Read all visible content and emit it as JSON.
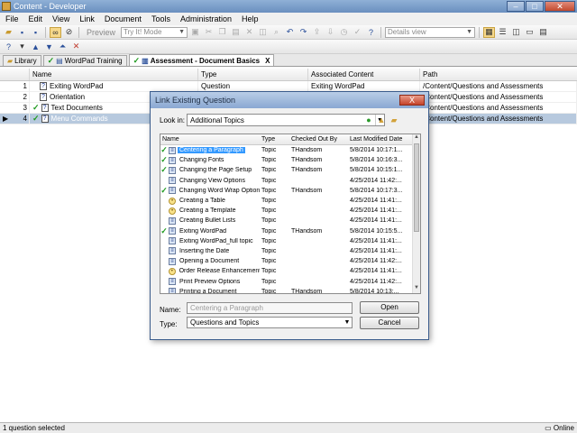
{
  "window": {
    "title": "Content - Developer"
  },
  "menu": [
    "File",
    "Edit",
    "View",
    "Link",
    "Document",
    "Tools",
    "Administration",
    "Help"
  ],
  "toolbar": {
    "preview_label": "Preview",
    "mode_combo": "Try It! Mode",
    "view_combo": "Details view"
  },
  "tabs": [
    {
      "label": "Library"
    },
    {
      "label": "WordPad Training"
    },
    {
      "label": "Assessment - Document Basics",
      "close": "X"
    }
  ],
  "grid": {
    "columns": [
      "Name",
      "Type",
      "Associated Content",
      "Path"
    ],
    "rows": [
      {
        "num": "1",
        "name": "Exiting WordPad",
        "type": "Question",
        "content": "Exiting WordPad",
        "path": "/Content/Questions and Assessments",
        "checked": false,
        "selected": false,
        "pointer": ""
      },
      {
        "num": "2",
        "name": "Orientation",
        "type": "Question",
        "content": "",
        "path": "/Content/Questions and Assessments",
        "checked": false,
        "selected": false,
        "pointer": ""
      },
      {
        "num": "3",
        "name": "Text Documents",
        "type": "Question",
        "content": "",
        "path": "/Content/Questions and Assessments",
        "checked": true,
        "selected": false,
        "pointer": ""
      },
      {
        "num": "4",
        "name": "Menu Commands",
        "type": "Question",
        "content": "",
        "path": "/Content/Questions and Assessments",
        "checked": true,
        "selected": true,
        "pointer": "▶"
      }
    ]
  },
  "status": {
    "left": "1 question selected",
    "right": "Online"
  },
  "dialog": {
    "title": "Link Existing Question",
    "close": "X",
    "lookin_label": "Look in:",
    "lookin_value": "Additional Topics",
    "columns": [
      "Name",
      "Type",
      "Checked Out By",
      "Last Modified Date"
    ],
    "items": [
      {
        "name": "Centering a Paragraph",
        "type": "Topic",
        "by": "THandsom",
        "date": "5/8/2014 10:17:1...",
        "checked": true,
        "icon": "doc",
        "selected": true
      },
      {
        "name": "Changing Fonts",
        "type": "Topic",
        "by": "THandsom",
        "date": "5/8/2014 10:16:3...",
        "checked": true,
        "icon": "doc",
        "selected": false
      },
      {
        "name": "Changing the Page Setup",
        "type": "Topic",
        "by": "THandsom",
        "date": "5/8/2014 10:15:1...",
        "checked": true,
        "icon": "doc",
        "selected": false
      },
      {
        "name": "Changing View Options",
        "type": "Topic",
        "by": "",
        "date": "4/25/2014 11:42:...",
        "checked": false,
        "icon": "doc",
        "selected": false
      },
      {
        "name": "Changing Word Wrap Options",
        "type": "Topic",
        "by": "THandsom",
        "date": "5/8/2014 10:17:3...",
        "checked": true,
        "icon": "doc",
        "selected": false
      },
      {
        "name": "Creating a Table",
        "type": "Topic",
        "by": "",
        "date": "4/25/2014 11:41:...",
        "checked": false,
        "icon": "bulb",
        "selected": false
      },
      {
        "name": "Creating a Template",
        "type": "Topic",
        "by": "",
        "date": "4/25/2014 11:41:...",
        "checked": false,
        "icon": "bulb",
        "selected": false
      },
      {
        "name": "Creating Bullet Lists",
        "type": "Topic",
        "by": "",
        "date": "4/25/2014 11:41:...",
        "checked": false,
        "icon": "doc",
        "selected": false
      },
      {
        "name": "Exiting WordPad",
        "type": "Topic",
        "by": "THandsom",
        "date": "5/8/2014 10:15:5...",
        "checked": true,
        "icon": "doc",
        "selected": false
      },
      {
        "name": "Exiting WordPad_full topic",
        "type": "Topic",
        "by": "",
        "date": "4/25/2014 11:41:...",
        "checked": false,
        "icon": "doc",
        "selected": false
      },
      {
        "name": "Inserting the Date",
        "type": "Topic",
        "by": "",
        "date": "4/25/2014 11:41:...",
        "checked": false,
        "icon": "doc",
        "selected": false
      },
      {
        "name": "Opening a Document",
        "type": "Topic",
        "by": "",
        "date": "4/25/2014 11:42:...",
        "checked": false,
        "icon": "doc",
        "selected": false
      },
      {
        "name": "Order Release Enhancements",
        "type": "Topic",
        "by": "",
        "date": "4/25/2014 11:41:...",
        "checked": false,
        "icon": "bulb",
        "selected": false
      },
      {
        "name": "Print Preview Options",
        "type": "Topic",
        "by": "",
        "date": "4/25/2014 11:42:...",
        "checked": false,
        "icon": "doc",
        "selected": false
      },
      {
        "name": "Printing a Document",
        "type": "Topic",
        "by": "THandsom",
        "date": "5/8/2014 10:13:...",
        "checked": false,
        "icon": "doc",
        "selected": false
      }
    ],
    "name_label": "Name:",
    "name_placeholder": "Centering a Paragraph",
    "type_label": "Type:",
    "type_value": "Questions and Topics",
    "open_label": "Open",
    "cancel_label": "Cancel"
  }
}
